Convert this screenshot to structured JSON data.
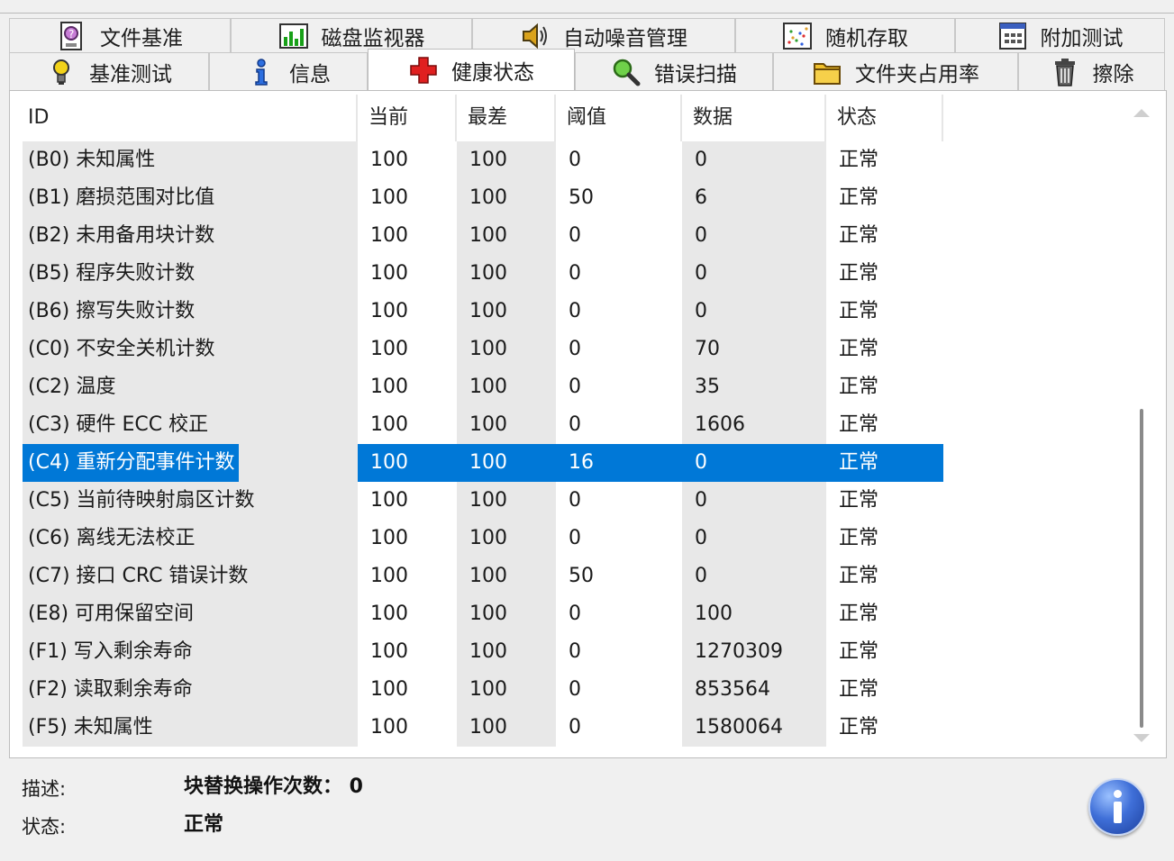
{
  "tabs_back": [
    {
      "label": "文件基准",
      "icon": "file-benchmark-icon"
    },
    {
      "label": "磁盘监视器",
      "icon": "disk-monitor-icon"
    },
    {
      "label": "自动噪音管理",
      "icon": "speaker-icon"
    },
    {
      "label": "随机存取",
      "icon": "random-access-icon"
    },
    {
      "label": "附加测试",
      "icon": "extra-tests-icon"
    }
  ],
  "tabs_front": [
    {
      "label": "基准测试",
      "icon": "benchmark-bulb-icon"
    },
    {
      "label": "信息",
      "icon": "info-icon"
    },
    {
      "label": "健康状态",
      "icon": "red-cross-icon",
      "active": true
    },
    {
      "label": "错误扫描",
      "icon": "magnifier-icon"
    },
    {
      "label": "文件夹占用率",
      "icon": "folder-icon"
    },
    {
      "label": "擦除",
      "icon": "trash-icon"
    }
  ],
  "columns": [
    "ID",
    "当前",
    "最差",
    "阈值",
    "数据",
    "状态"
  ],
  "rows": [
    {
      "id": "(B0) 未知属性",
      "current": "100",
      "worst": "100",
      "threshold": "0",
      "data": "0",
      "status": "正常"
    },
    {
      "id": "(B1) 磨损范围对比值",
      "current": "100",
      "worst": "100",
      "threshold": "50",
      "data": "6",
      "status": "正常"
    },
    {
      "id": "(B2) 未用备用块计数",
      "current": "100",
      "worst": "100",
      "threshold": "0",
      "data": "0",
      "status": "正常"
    },
    {
      "id": "(B5) 程序失败计数",
      "current": "100",
      "worst": "100",
      "threshold": "0",
      "data": "0",
      "status": "正常"
    },
    {
      "id": "(B6) 擦写失败计数",
      "current": "100",
      "worst": "100",
      "threshold": "0",
      "data": "0",
      "status": "正常"
    },
    {
      "id": "(C0) 不安全关机计数",
      "current": "100",
      "worst": "100",
      "threshold": "0",
      "data": "70",
      "status": "正常"
    },
    {
      "id": "(C2) 温度",
      "current": "100",
      "worst": "100",
      "threshold": "0",
      "data": "35",
      "status": "正常"
    },
    {
      "id": "(C3) 硬件 ECC 校正",
      "current": "100",
      "worst": "100",
      "threshold": "0",
      "data": "1606",
      "status": "正常"
    },
    {
      "id": "(C4) 重新分配事件计数",
      "current": "100",
      "worst": "100",
      "threshold": "16",
      "data": "0",
      "status": "正常",
      "selected": true
    },
    {
      "id": "(C5) 当前待映射扇区计数",
      "current": "100",
      "worst": "100",
      "threshold": "0",
      "data": "0",
      "status": "正常"
    },
    {
      "id": "(C6) 离线无法校正",
      "current": "100",
      "worst": "100",
      "threshold": "0",
      "data": "0",
      "status": "正常"
    },
    {
      "id": "(C7) 接口 CRC 错误计数",
      "current": "100",
      "worst": "100",
      "threshold": "50",
      "data": "0",
      "status": "正常"
    },
    {
      "id": "(E8) 可用保留空间",
      "current": "100",
      "worst": "100",
      "threshold": "0",
      "data": "100",
      "status": "正常"
    },
    {
      "id": "(F1) 写入剩余寿命",
      "current": "100",
      "worst": "100",
      "threshold": "0",
      "data": "1270309",
      "status": "正常"
    },
    {
      "id": "(F2) 读取剩余寿命",
      "current": "100",
      "worst": "100",
      "threshold": "0",
      "data": "853564",
      "status": "正常"
    },
    {
      "id": "(F5) 未知属性",
      "current": "100",
      "worst": "100",
      "threshold": "0",
      "data": "1580064",
      "status": "正常"
    }
  ],
  "footer": {
    "description_label": "描述:",
    "description_value": "块替换操作次数： 0",
    "status_label": "状态:",
    "status_value": "正常"
  },
  "colors": {
    "selection": "#0078d7",
    "shaded_column": "#e8e8e8",
    "info_button": "#3f6fd8"
  }
}
